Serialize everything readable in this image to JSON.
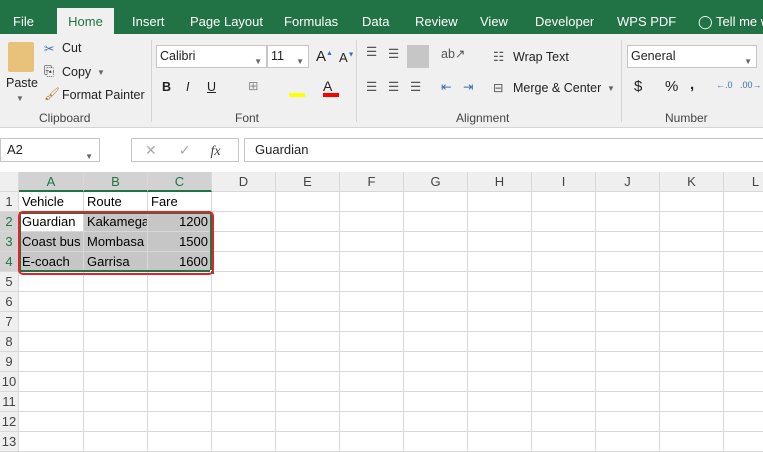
{
  "tabs": [
    "File",
    "Home",
    "Insert",
    "Page Layout",
    "Formulas",
    "Data",
    "Review",
    "View",
    "Developer",
    "WPS PDF",
    "Tell me wh"
  ],
  "clipboard": {
    "paste": "Paste",
    "cut": "Cut",
    "copy": "Copy",
    "format_painter": "Format Painter",
    "label": "Clipboard"
  },
  "font": {
    "name": "Calibri",
    "size": "11",
    "bold": "B",
    "italic": "I",
    "underline": "U",
    "label": "Font"
  },
  "alignment": {
    "wrap_text": "Wrap Text",
    "merge_center": "Merge & Center",
    "label": "Alignment"
  },
  "number": {
    "format": "General",
    "currency": "$",
    "percent": "%",
    "comma": ",",
    "label": "Number"
  },
  "formula_bar": {
    "name_box": "A2",
    "fx": "fx",
    "value": "Guardian"
  },
  "columns": [
    "A",
    "B",
    "C",
    "D",
    "E",
    "F",
    "G",
    "H",
    "I",
    "J",
    "K",
    "L"
  ],
  "rows": [
    "1",
    "2",
    "3",
    "4",
    "5",
    "6",
    "7",
    "8",
    "9",
    "10",
    "11",
    "12",
    "13"
  ],
  "cells": [
    [
      "Vehicle",
      "Route",
      "Fare"
    ],
    [
      "Guardian",
      "Kakamega",
      "1200"
    ],
    [
      "Coast bus",
      "Mombasa",
      "1500"
    ],
    [
      "E-coach",
      "Garrisa",
      "1600"
    ]
  ],
  "colors": {
    "accent": "#217346",
    "highlight": "#ff0000"
  }
}
